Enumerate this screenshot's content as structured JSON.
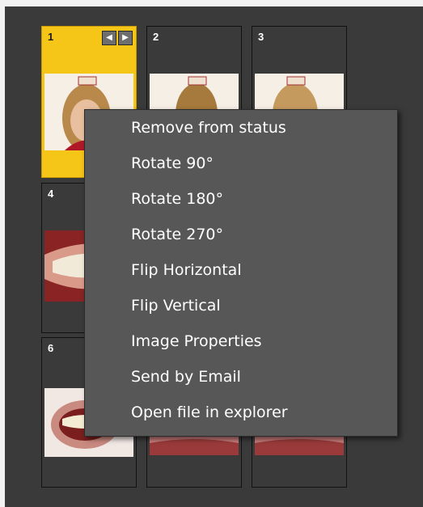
{
  "thumbnails": [
    {
      "number": "1",
      "selected": true,
      "kind": "face"
    },
    {
      "number": "2",
      "selected": false,
      "kind": "face"
    },
    {
      "number": "3",
      "selected": false,
      "kind": "face"
    },
    {
      "number": "4",
      "selected": false,
      "kind": "mouth"
    },
    {
      "number": "6",
      "selected": false,
      "kind": "mouth"
    }
  ],
  "thumbnail_nav": {
    "prev_icon": "chevron-left-icon",
    "next_icon": "chevron-right-icon"
  },
  "context_menu": {
    "items": [
      {
        "label": "Remove from status"
      },
      {
        "label": "Rotate 90°"
      },
      {
        "label": "Rotate 180°"
      },
      {
        "label": "Rotate 270°"
      },
      {
        "label": "Flip Horizontal"
      },
      {
        "label": "Flip Vertical"
      },
      {
        "label": "Image Properties"
      },
      {
        "label": "Send by Email"
      },
      {
        "label": "Open file in explorer"
      }
    ]
  },
  "colors": {
    "panel_bg": "#3a3a3a",
    "selected_tile": "#f5c518",
    "menu_bg": "#575757",
    "menu_text": "#ffffff"
  }
}
